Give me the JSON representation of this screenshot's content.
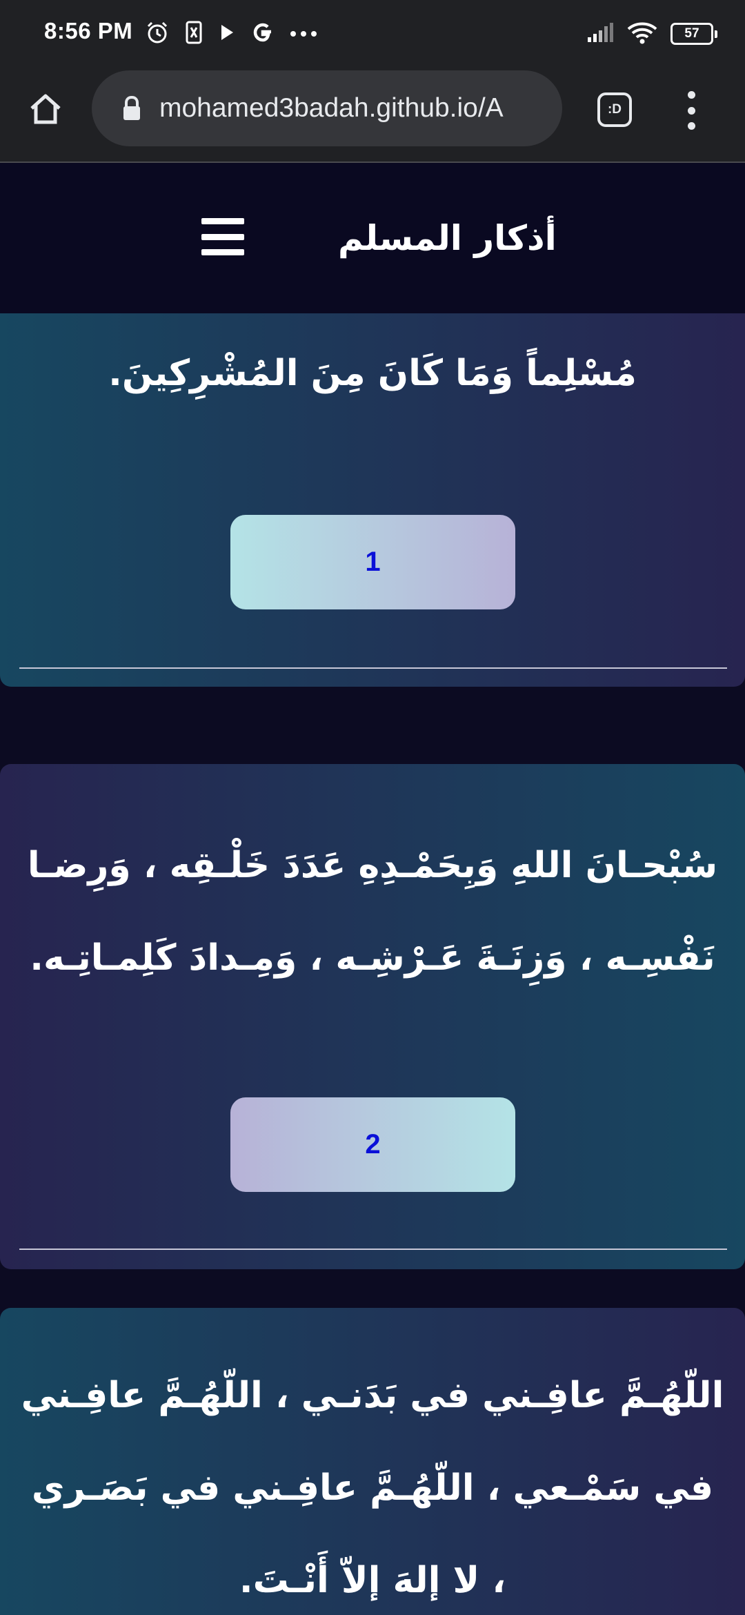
{
  "status_bar": {
    "time": "8:56 PM",
    "battery": "57",
    "left_icons": [
      "alarm-icon",
      "sim-icon",
      "play-icon",
      "google-icon",
      "more-icon"
    ],
    "right_icons": [
      "signal-icon",
      "wifi-icon",
      "battery-icon"
    ]
  },
  "browser": {
    "url": "mohamed3badah.github.io/A",
    "tabs_label": ":D",
    "icons": [
      "home-icon",
      "lock-icon",
      "menu-icon"
    ]
  },
  "header": {
    "title": "أذكار المسلم"
  },
  "cards": [
    {
      "text": "مُسْلِماً وَمَا كَانَ مِنَ المُشْرِكِينَ.",
      "count": "1"
    },
    {
      "text": "سُبْحـانَ اللهِ وَبِحَمْـدِهِ عَدَدَ خَلْـقِه ، وَرِضـا نَفْسِـه ، وَزِنَـةَ عَـرْشِـه ، وَمِـدادَ كَلِمـاتِـه.",
      "count": "2"
    },
    {
      "text": "اللّهُـمَّ عافِـني في بَدَنـي ، اللّهُـمَّ عافِـني في سَمْـعي ، اللّهُـمَّ عافِـني في بَصَـري ، لا إلهَ إلاّ أَنْـتَ."
    }
  ],
  "colors": {
    "page_bg": "#0c0b22",
    "chrome_bg": "#202124",
    "counter_text": "#0a10d8"
  }
}
